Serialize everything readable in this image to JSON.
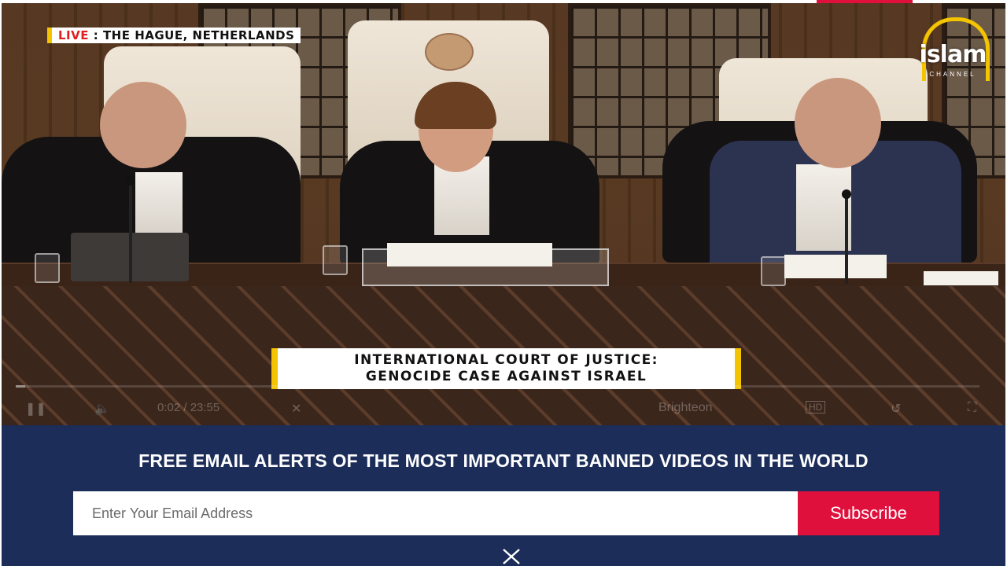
{
  "video": {
    "live_label": "LIVE",
    "location_label": ": THE HAGUE, NETHERLANDS",
    "logo_text": "islam",
    "logo_sub": "CHANNEL",
    "lower_third_line1": "INTERNATIONAL COURT OF JUSTICE:",
    "lower_third_line2": "GENOCIDE CASE AGAINST ISRAEL",
    "time_display": "0:02 / 23:55",
    "player_brand": "Brighteon",
    "progress_fraction": 0.001
  },
  "banner": {
    "title": "FREE EMAIL ALERTS OF THE MOST IMPORTANT BANNED VIDEOS IN THE WORLD",
    "email_placeholder": "Enter Your Email Address",
    "subscribe_label": "Subscribe"
  },
  "colors": {
    "banner_bg": "#1c2d5a",
    "subscribe_bg": "#e0103d",
    "accent_yellow": "#f4c400"
  }
}
